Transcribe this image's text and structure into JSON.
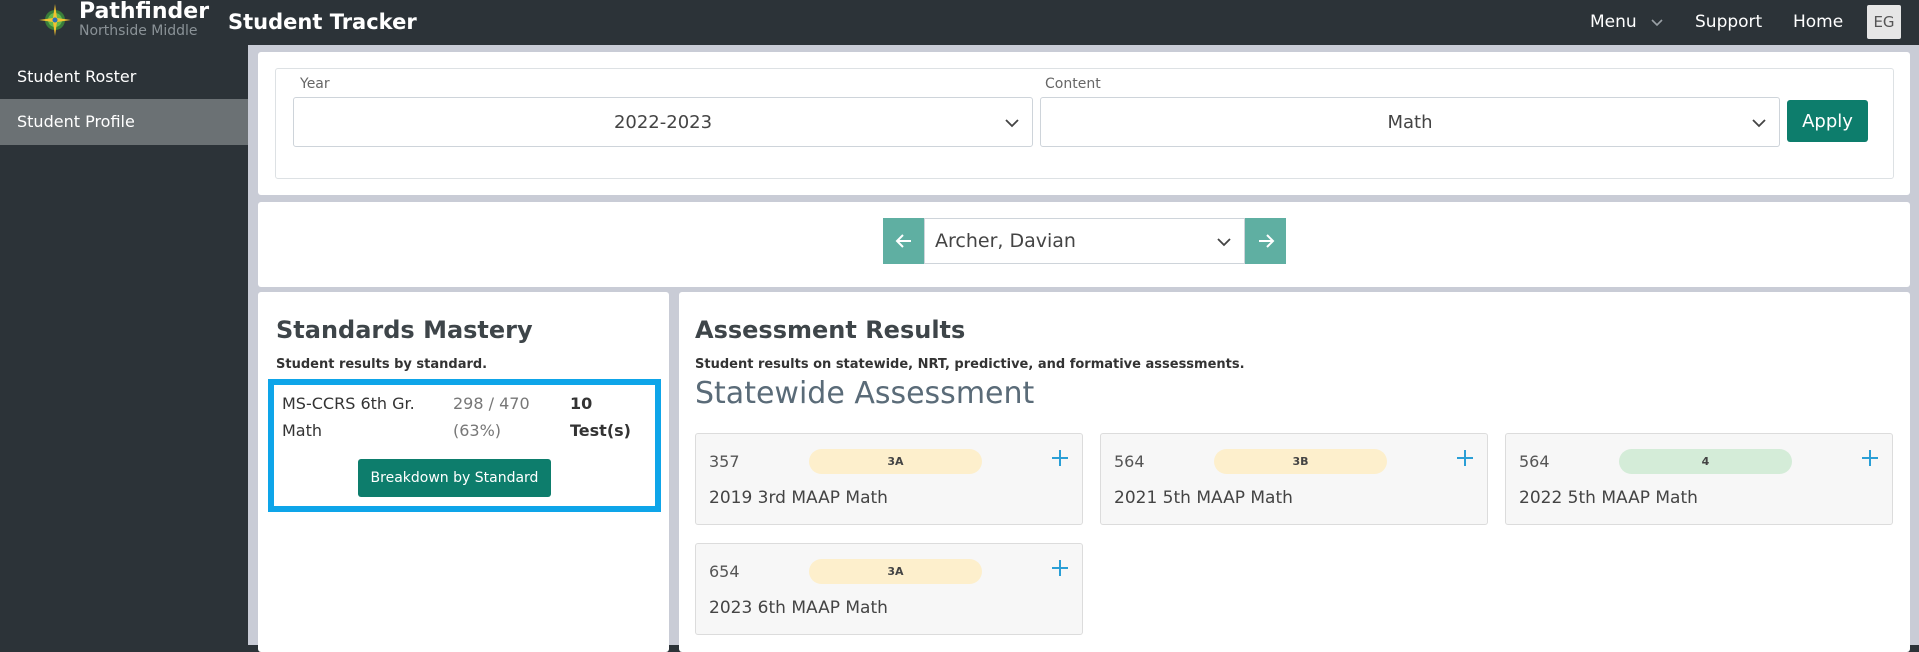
{
  "header": {
    "brand_name": "Pathfinder",
    "brand_sub": "Northside Middle",
    "app_title": "Student Tracker",
    "menu_label": "Menu",
    "support_label": "Support",
    "home_label": "Home",
    "avatar_initials": "EG"
  },
  "sidebar": {
    "items": [
      {
        "label": "Student Roster",
        "active": false
      },
      {
        "label": "Student Profile",
        "active": true
      }
    ]
  },
  "filters": {
    "year_label": "Year",
    "year_value": "2022-2023",
    "content_label": "Content",
    "content_value": "Math",
    "apply_label": "Apply"
  },
  "student_nav": {
    "student_name": "Archer, Davian",
    "prev_icon": "arrow-left-icon",
    "next_icon": "arrow-right-icon"
  },
  "standards": {
    "title": "Standards Mastery",
    "subtitle": "Student results by standard.",
    "item": {
      "name_line1": "MS-CCRS 6th Gr.",
      "name_line2": "Math",
      "score_line1": "298 / 470",
      "score_line2": "(63%)",
      "tests_line1": "10",
      "tests_line2": "Test(s)",
      "button_label": "Breakdown by Standard"
    }
  },
  "assessments": {
    "title": "Assessment Results",
    "subtitle": "Student results on statewide, NRT, predictive, and formative assessments.",
    "section_title": "Statewide Assessment",
    "items": [
      {
        "score": "357",
        "level": "3A",
        "name": "2019 3rd MAAP Math",
        "badge_color": "#fdefcc"
      },
      {
        "score": "564",
        "level": "3B",
        "name": "2021 5th MAAP Math",
        "badge_color": "#fdefcc"
      },
      {
        "score": "564",
        "level": "4",
        "name": "2022 5th MAAP Math",
        "badge_color": "#d4ecd8"
      },
      {
        "score": "654",
        "level": "3A",
        "name": "2023 6th MAAP Math",
        "badge_color": "#fdefcc"
      }
    ]
  },
  "colors": {
    "accent": "#0d7d6c",
    "arrow_button": "#5fafa2",
    "highlight": "#0ea5e9",
    "plus_icon": "#2a9fd6"
  }
}
